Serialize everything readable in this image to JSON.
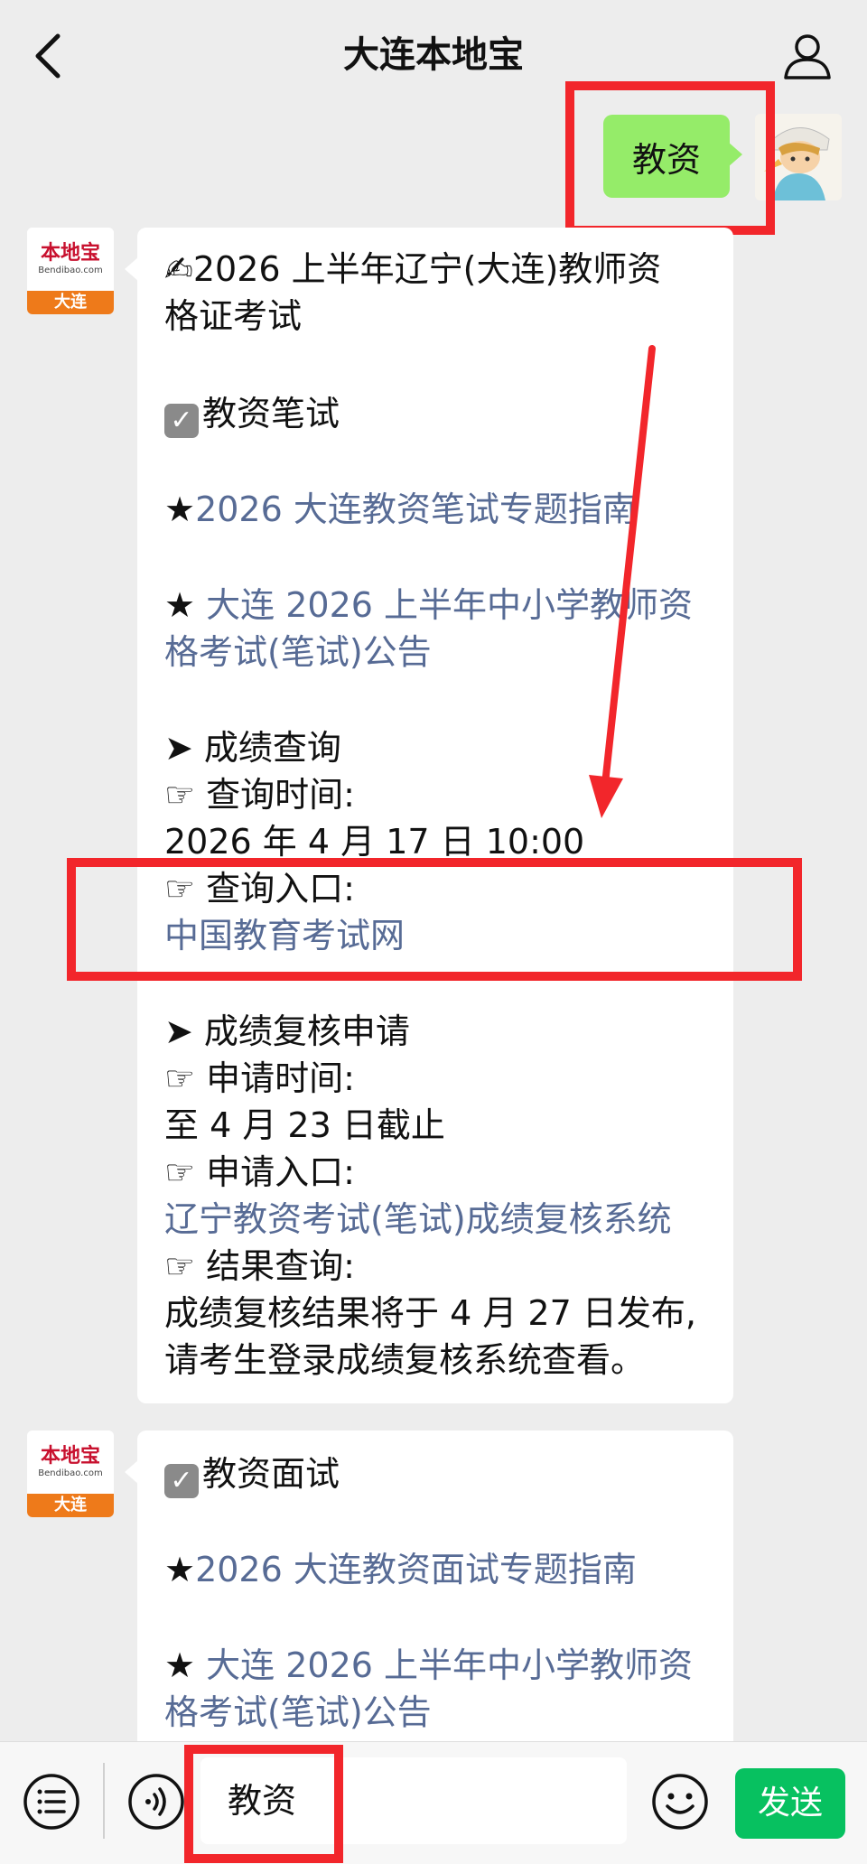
{
  "header": {
    "title": "大连本地宝"
  },
  "self_message": {
    "text": "教资"
  },
  "bot_avatar": {
    "logo_main": "本地宝",
    "logo_sub": "Bendibao.com",
    "logo_city": "大连"
  },
  "message1": {
    "title_line1": "✍2026 上半年辽宁(大连)教师资",
    "title_line2": "格证考试",
    "section_written": "教资笔试",
    "star1_prefix": "★",
    "star1_link": "2026 大连教资笔试专题指南",
    "star2_prefix": "★ ",
    "star2_link_line1": "大连 2026 上半年中小学教师资",
    "star2_link_line2": "格考试(笔试)公告",
    "score_heading": "➤ 成绩查询",
    "query_time_label": "☞ 查询时间:",
    "query_time_value": "2026 年 4 月 17 日 10:00",
    "query_entry_label": "☞ 查询入口:",
    "query_entry_link": "中国教育考试网",
    "review_heading": "➤ 成绩复核申请",
    "apply_time_label": "☞ 申请时间:",
    "apply_time_value": "至 4 月 23 日截止",
    "apply_entry_label": "☞ 申请入口:",
    "apply_entry_link": "辽宁教资考试(笔试)成绩复核系统",
    "result_label": "☞ 结果查询:",
    "result_line1": "成绩复核结果将于 4 月 27 日发布,",
    "result_line2": "请考生登录成绩复核系统查看。"
  },
  "message2": {
    "section_interview": "教资面试",
    "star1_prefix": "★",
    "star1_link": "2026 大连教资面试专题指南",
    "star2_prefix": "★ ",
    "star2_link_line1": "大连 2026 上半年中小学教师资",
    "star2_link_line2": "格考试(笔试)公告"
  },
  "input_bar": {
    "input_value": "教资",
    "send_label": "发送"
  },
  "colors": {
    "self_bubble": "#95ec69",
    "link": "#576b95",
    "send_button": "#07c160",
    "highlight": "#f2262b"
  },
  "icons": [
    "back-icon",
    "user-icon",
    "menu-icon",
    "voice-icon",
    "emoji-icon",
    "check-icon"
  ]
}
